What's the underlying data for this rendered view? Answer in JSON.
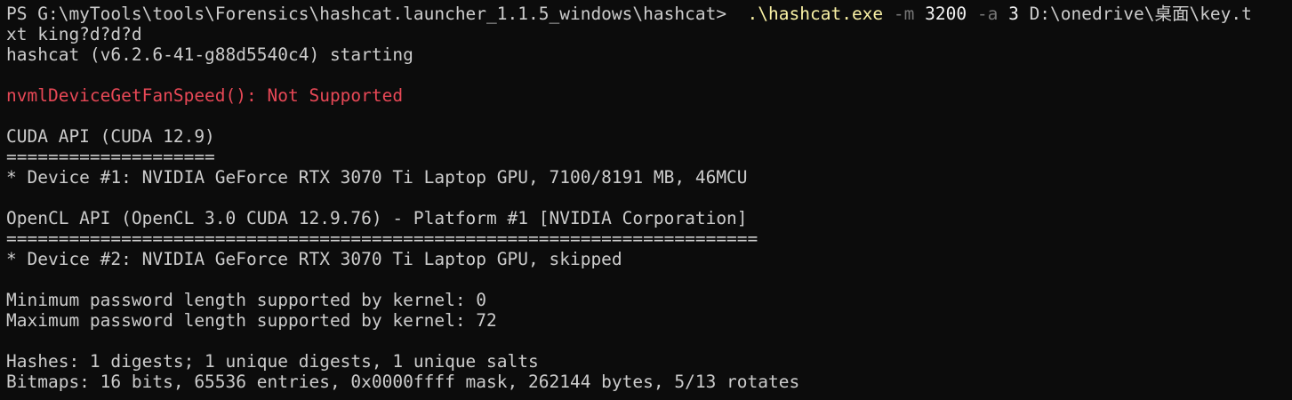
{
  "terminal": {
    "lines": [
      {
        "segments": [
          {
            "text": "PS G:\\myTools\\tools\\Forensics\\hashcat.launcher_1.1.5_windows\\hashcat>  ",
            "color": "default"
          },
          {
            "text": ".\\hashcat.exe",
            "color": "yellow"
          },
          {
            "text": " -m ",
            "color": "gray"
          },
          {
            "text": "3200",
            "color": "white"
          },
          {
            "text": " -a ",
            "color": "gray"
          },
          {
            "text": "3",
            "color": "white"
          },
          {
            "text": " D:\\onedrive\\桌面\\key.t",
            "color": "default"
          }
        ]
      },
      {
        "segments": [
          {
            "text": "xt king?d?d?d",
            "color": "default"
          }
        ]
      },
      {
        "segments": [
          {
            "text": "hashcat (v6.2.6-41-g88d5540c4) starting",
            "color": "default"
          }
        ]
      },
      {
        "segments": []
      },
      {
        "segments": [
          {
            "text": "nvmlDeviceGetFanSpeed(): Not Supported",
            "color": "red"
          }
        ]
      },
      {
        "segments": []
      },
      {
        "segments": [
          {
            "text": "CUDA API (CUDA 12.9)",
            "color": "default"
          }
        ]
      },
      {
        "segments": [
          {
            "text": "====================",
            "color": "default"
          }
        ]
      },
      {
        "segments": [
          {
            "text": "* Device #1: NVIDIA GeForce RTX 3070 Ti Laptop GPU, 7100/8191 MB, 46MCU",
            "color": "default"
          }
        ]
      },
      {
        "segments": []
      },
      {
        "segments": [
          {
            "text": "OpenCL API (OpenCL 3.0 CUDA 12.9.76) - Platform #1 [NVIDIA Corporation]",
            "color": "default"
          }
        ]
      },
      {
        "segments": [
          {
            "text": "========================================================================",
            "color": "default"
          }
        ]
      },
      {
        "segments": [
          {
            "text": "* Device #2: NVIDIA GeForce RTX 3070 Ti Laptop GPU, skipped",
            "color": "default"
          }
        ]
      },
      {
        "segments": []
      },
      {
        "segments": [
          {
            "text": "Minimum password length supported by kernel: 0",
            "color": "default"
          }
        ]
      },
      {
        "segments": [
          {
            "text": "Maximum password length supported by kernel: 72",
            "color": "default"
          }
        ]
      },
      {
        "segments": []
      },
      {
        "segments": [
          {
            "text": "Hashes: 1 digests; 1 unique digests, 1 unique salts",
            "color": "default"
          }
        ]
      },
      {
        "segments": [
          {
            "text": "Bitmaps: 16 bits, 65536 entries, 0x0000ffff mask, 262144 bytes, 5/13 rotates",
            "color": "default"
          }
        ]
      }
    ]
  },
  "colors": {
    "background": "#0c0c0c",
    "default": "#cccccc",
    "yellow": "#f9f1a5",
    "gray": "#767676",
    "white": "#f2f2f2",
    "red": "#e74856"
  }
}
